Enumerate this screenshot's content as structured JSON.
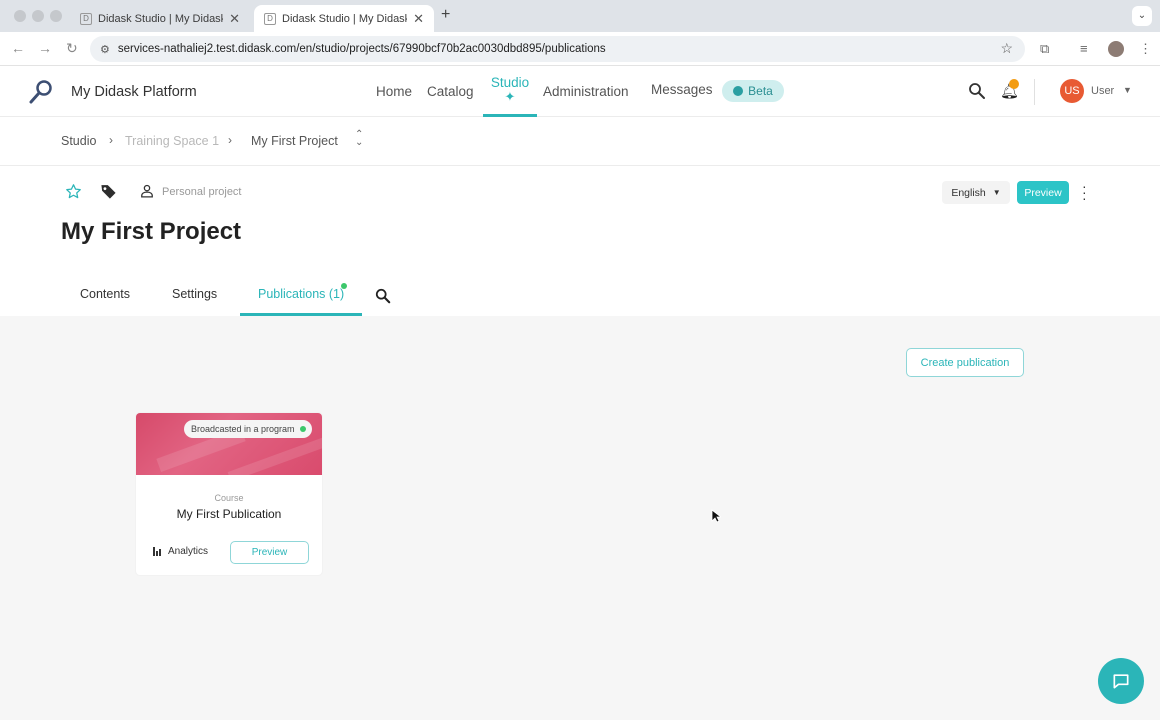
{
  "browser": {
    "tabs": [
      {
        "title": "Didask Studio | My Didask Pla",
        "active": false
      },
      {
        "title": "Didask Studio | My Didask Pla",
        "active": true
      }
    ],
    "new_tab_label": "+",
    "url": "services-nathaliej2.test.didask.com/en/studio/projects/67990bcf70b2ac0030dbd895/publications"
  },
  "header": {
    "brand": "My Didask Platform",
    "nav": {
      "home": "Home",
      "catalog": "Catalog",
      "studio": "Studio",
      "administration": "Administration",
      "messages": "Messages",
      "beta": "Beta"
    },
    "user": {
      "initials": "US",
      "name": "User"
    }
  },
  "breadcrumb": {
    "items": [
      "Studio",
      "Training Space 1",
      "My First Project"
    ]
  },
  "project": {
    "ownership": "Personal project",
    "title": "My First Project",
    "language": "English",
    "preview_label": "Preview",
    "tabs": {
      "contents": "Contents",
      "settings": "Settings",
      "publications": "Publications (1)"
    }
  },
  "publications": {
    "create_label": "Create publication",
    "cards": [
      {
        "badge": "Broadcasted in a program",
        "type": "Course",
        "title": "My First Publication",
        "analytics_label": "Analytics",
        "preview_label": "Preview"
      }
    ]
  },
  "colors": {
    "accent": "#2bb5b8",
    "avatar": "#e85a33",
    "notification": "#f39c12",
    "status_green": "#3cc76b",
    "card_image": "#d94b6d"
  },
  "icons": [
    "search-icon",
    "bell-icon",
    "star-icon",
    "tag-icon",
    "person-icon",
    "chat-icon",
    "sparkle-icon"
  ]
}
